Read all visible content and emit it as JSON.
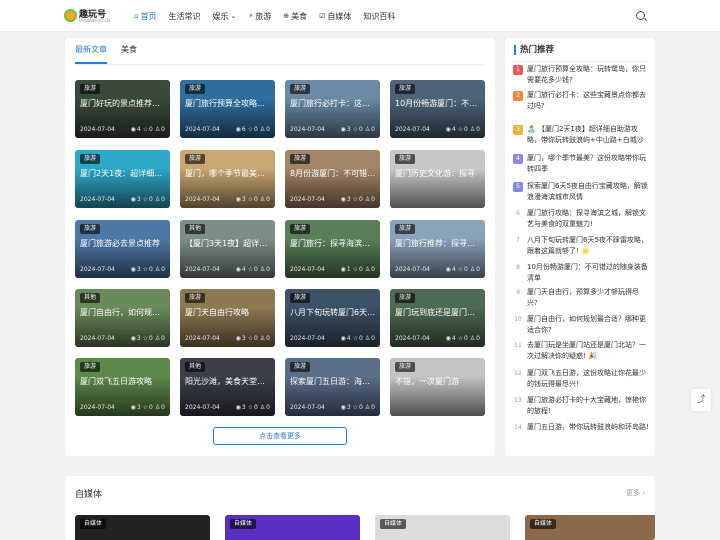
{
  "header": {
    "logo_text": "趣玩号",
    "logo_sub": "QUWANHAO.CN",
    "nav": [
      {
        "icon": "⌂",
        "label": "首页",
        "active": true
      },
      {
        "icon": "",
        "label": "生活常识"
      },
      {
        "icon": "",
        "label": "娱乐",
        "dropdown": "⌄"
      },
      {
        "icon": "⚡",
        "label": "旅游"
      },
      {
        "icon": "⊕",
        "label": "美食"
      },
      {
        "icon": "☑",
        "label": "自媒体"
      },
      {
        "icon": "",
        "label": "知识百科"
      }
    ]
  },
  "main": {
    "tabs": [
      "最新文章",
      "美食"
    ],
    "cards": [
      {
        "badge": "旅游",
        "title": "厦门好玩的景点推荐旅游",
        "date": "2024-07-04",
        "views": "4",
        "comments": "0",
        "likes": "0",
        "color": "#3a4a3a"
      },
      {
        "badge": "旅游",
        "title": "厦门旅行预算全攻略：玩转",
        "date": "2024-07-04",
        "views": "6",
        "comments": "0",
        "likes": "0",
        "color": "#2f6fa0"
      },
      {
        "badge": "旅游",
        "title": "厦门旅行必打卡：这些宝",
        "date": "2024-07-04",
        "views": "3",
        "comments": "0",
        "likes": "0",
        "color": "#6b8aa6"
      },
      {
        "badge": "旅游",
        "title": "10月份畅游厦门：不可错",
        "date": "2024-07-04",
        "views": "4",
        "comments": "0",
        "likes": "0",
        "color": "#4d6478"
      },
      {
        "badge": "旅游",
        "title": "厦门2天1夜：超详细自助游",
        "date": "2024-07-04",
        "views": "3",
        "comments": "0",
        "likes": "0",
        "color": "#2fa7c8"
      },
      {
        "badge": "旅游",
        "title": "厦门，哪个季节最美？这份",
        "date": "2024-07-04",
        "views": "3",
        "comments": "0",
        "likes": "0",
        "color": "#c9a672"
      },
      {
        "badge": "旅游",
        "title": "8月份游厦门：不可错过的",
        "date": "2024-07-04",
        "views": "3",
        "comments": "0",
        "likes": "0",
        "color": "#a38567"
      },
      {
        "badge": "旅游",
        "title": "厦门历史文化游：探寻",
        "date": "",
        "views": "",
        "comments": "",
        "likes": "",
        "color": "#c8c8c8"
      },
      {
        "badge": "旅游",
        "title": "厦门旅游必去景点推荐",
        "date": "2024-07-04",
        "views": "3",
        "comments": "0",
        "likes": "0",
        "color": "#4d78a8"
      },
      {
        "badge": "其他",
        "title": "【厦门3天1夜】超详细自助游攻略",
        "date": "2024-07-04",
        "views": "4",
        "comments": "0",
        "likes": "0",
        "color": "#7d8e8a"
      },
      {
        "badge": "旅游",
        "title": "厦门旅行：探寻海滨之城",
        "date": "2024-07-04",
        "views": "1",
        "comments": "0",
        "likes": "0",
        "color": "#5a7f5a"
      },
      {
        "badge": "旅游",
        "title": "厦门旅行推荐：探寻海滨",
        "date": "2024-07-04",
        "views": "4",
        "comments": "0",
        "likes": "0",
        "color": "#8aa2b8"
      },
      {
        "badge": "其他",
        "title": "厦门自由行，如何规划最合适",
        "date": "2024-07-04",
        "views": "3",
        "comments": "0",
        "likes": "0",
        "color": "#6a8a5a"
      },
      {
        "badge": "旅游",
        "title": "厦门天自由行攻略",
        "date": "2024-07-04",
        "views": "3",
        "comments": "0",
        "likes": "0",
        "color": "#8c7a52"
      },
      {
        "badge": "旅游",
        "title": "八月下旬玩转厦门6天5晚",
        "date": "2024-07-04",
        "views": "4",
        "comments": "0",
        "likes": "0",
        "color": "#3d5266"
      },
      {
        "badge": "旅游",
        "title": "厦门玩到底还是厦门北站",
        "date": "2024-07-04",
        "views": "4",
        "comments": "0",
        "likes": "0",
        "color": "#4f6a52"
      },
      {
        "badge": "旅游",
        "title": "厦门双飞五日游攻略",
        "date": "2024-07-04",
        "views": "3",
        "comments": "0",
        "likes": "0",
        "color": "#5d8a4a"
      },
      {
        "badge": "其他",
        "title": "阳光沙滩，美食天堂：探寻厦门十大必去景点",
        "date": "2024-07-04",
        "views": "3",
        "comments": "0",
        "likes": "0",
        "color": "#3a3f4a"
      },
      {
        "badge": "旅游",
        "title": "探索厦门五日游：海滨之城",
        "date": "2024-07-04",
        "views": "3",
        "comments": "0",
        "likes": "0",
        "color": "#5a6e8a"
      },
      {
        "badge": "旅游",
        "title": "不错，一次厦门游",
        "date": "",
        "views": "",
        "comments": "",
        "likes": "",
        "color": "#c4c4c4"
      }
    ],
    "more_label": "点击查看更多"
  },
  "sidebar": {
    "title": "热门推荐",
    "items": [
      {
        "num": "1",
        "text": "厦门旅行预算全攻略：玩转鹭岛，你只需要花多少钱?",
        "color": "#e85a5a"
      },
      {
        "num": "2",
        "text": "厦门旅行必打卡：这些宝藏景点你都去过吗?",
        "color": "#f08a3a"
      },
      {
        "num": "3",
        "text": "🏝️ 【厦门2天1夜】超详细自助游攻略，带你玩转鼓浪屿+中山路+白城沙滩 🏝️",
        "color": "#f0b23a"
      },
      {
        "num": "4",
        "text": "厦门，哪个季节最美？这份攻略带你玩转四季",
        "color": "#8a8ae0"
      },
      {
        "num": "5",
        "text": "探索厦门6天5夜自由行宝藏攻略，解锁浪漫海滨城市风情",
        "color": "#8a8ae0"
      },
      {
        "num": "6",
        "text": "厦门旅行攻略：探寻海滨之城，解锁文艺与美食的双重魅力!",
        "color": "#ffffff"
      },
      {
        "num": "7",
        "text": "八月下旬玩转厦门6天5夜不踩雷攻略，跟着这篇就够了! 🌟",
        "color": "#ffffff"
      },
      {
        "num": "8",
        "text": "10月份畅游厦门：不可错过的随身装备清单",
        "color": "#ffffff"
      },
      {
        "num": "9",
        "text": "厦门天自由行，预算多少才够玩得尽兴?",
        "color": "#ffffff"
      },
      {
        "num": "10",
        "text": "厦门自由行，如何规划最合适？哪种更适合你?",
        "color": "#ffffff"
      },
      {
        "num": "11",
        "text": "去厦门玩是坐厦门站还是厦门北站？一次过解决你的疑惑! 🎉",
        "color": "#ffffff"
      },
      {
        "num": "12",
        "text": "厦门双飞五日游，这份攻略让你花最少的钱玩得最尽兴!",
        "color": "#ffffff"
      },
      {
        "num": "13",
        "text": "厦门旅游必打卡的十大宝藏地，惊艳你的旅程!",
        "color": "#ffffff"
      },
      {
        "num": "14",
        "text": "厦门五日游，带你玩转鼓浪屿和环岛路!",
        "color": "#ffffff"
      }
    ]
  },
  "media": {
    "title": "自媒体",
    "more": "更多 ›",
    "cards": [
      {
        "badge": "自媒体",
        "color": "#222"
      },
      {
        "badge": "自媒体",
        "color": "#5a2fc4"
      },
      {
        "badge": "自媒体",
        "color": "#dcdcdc"
      },
      {
        "badge": "自媒体",
        "color": "#8a6a4a"
      }
    ]
  },
  "float": {
    "share_icon": "share-icon"
  }
}
